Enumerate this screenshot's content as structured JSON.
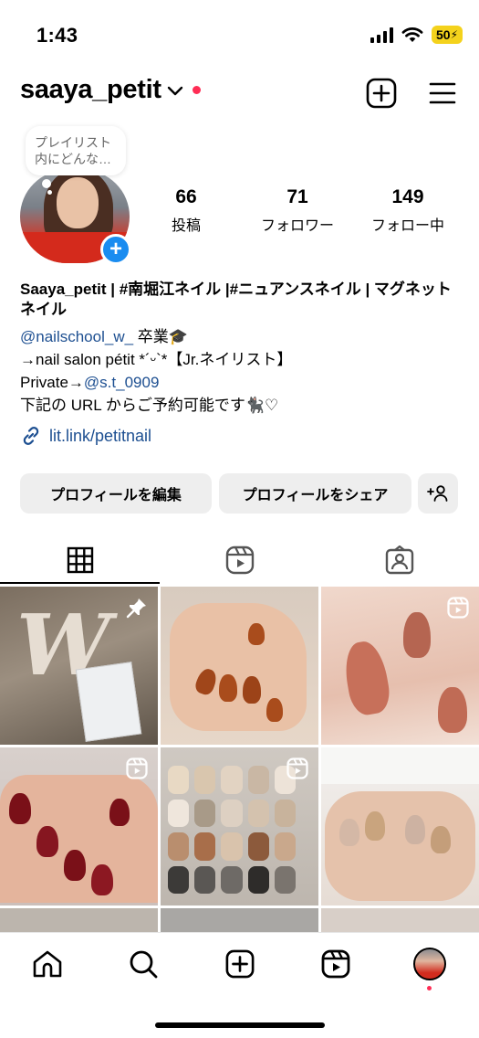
{
  "status_bar": {
    "time": "1:43",
    "battery": "50"
  },
  "header": {
    "username": "saaya_petit"
  },
  "profile": {
    "note": "プレイリスト内にどんな…",
    "stats": [
      {
        "value": "66",
        "label": "投稿"
      },
      {
        "value": "71",
        "label": "フォロワー"
      },
      {
        "value": "149",
        "label": "フォロー中"
      }
    ],
    "display_name": "Saaya_petit | #南堀江ネイル |#ニュアンスネイル | マグネットネイル",
    "bio": {
      "line1_mention": "@nailschool_w_",
      "line1_text": " 卒業🎓",
      "line2": "→nail salon pétit *´ᵕ`*【Jr.ネイリスト】",
      "line3_text": "Private→",
      "line3_mention": "@s.t_0909",
      "line4": "下記の URL からご予約可能です🐈‍⬛♡"
    },
    "link": "lit.link/petitnail"
  },
  "actions": {
    "edit_profile": "プロフィールを編集",
    "share_profile": "プロフィールをシェア"
  },
  "tabs": [
    {
      "name": "grid",
      "icon": "grid-icon",
      "active": true
    },
    {
      "name": "reels",
      "icon": "reels-icon",
      "active": false
    },
    {
      "name": "tagged",
      "icon": "tagged-icon",
      "active": false
    }
  ],
  "posts": [
    {
      "type": "pinned",
      "badge": "pin-icon"
    },
    {
      "type": "photo",
      "badge": ""
    },
    {
      "type": "reel",
      "badge": "reels-icon"
    },
    {
      "type": "reel",
      "badge": "reels-icon"
    },
    {
      "type": "reel",
      "badge": "reels-icon"
    },
    {
      "type": "photo",
      "badge": ""
    }
  ],
  "bottom_nav": [
    "home-icon",
    "search-icon",
    "create-icon",
    "reels-icon",
    "profile-avatar"
  ],
  "colors": {
    "link": "#1d4f91",
    "accent_blue": "#1a8cf0",
    "notification_red": "#ff2d55",
    "button_bg": "#eeeeee"
  }
}
